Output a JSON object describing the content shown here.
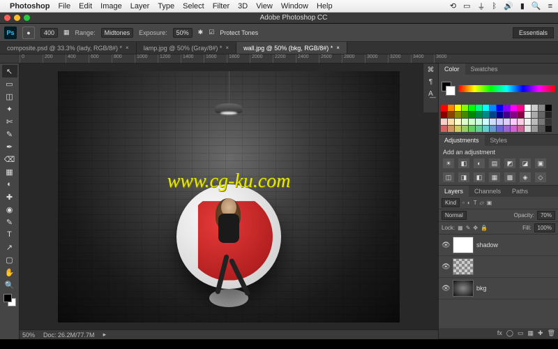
{
  "menubar": {
    "app": "Photoshop",
    "items": [
      "File",
      "Edit",
      "Image",
      "Layer",
      "Type",
      "Select",
      "Filter",
      "3D",
      "View",
      "Window",
      "Help"
    ],
    "right_icons": [
      "sync-icon",
      "display-icon",
      "wifi-icon",
      "bluetooth-icon",
      "volume-icon",
      "battery-icon",
      "clock-icon",
      "search-icon",
      "menu-icon"
    ]
  },
  "titlebar": {
    "title": "Adobe Photoshop CC"
  },
  "options": {
    "tool_size": "400",
    "range_label": "Range:",
    "range_value": "Midtones",
    "exposure_label": "Exposure:",
    "exposure_value": "50%",
    "protect_tones": "Protect Tones",
    "workspace": "Essentials"
  },
  "tabs": [
    {
      "label": "composite.psd @ 33.3% (lady, RGB/8#) *",
      "active": false
    },
    {
      "label": "lamp.jpg @ 50% (Gray/8#) *",
      "active": false
    },
    {
      "label": "wall.jpg @ 50% (bkg, RGB/8#) *",
      "active": true
    }
  ],
  "ruler_ticks": [
    "0",
    "200",
    "400",
    "600",
    "800",
    "1000",
    "1200",
    "1400",
    "1600",
    "1800",
    "2000",
    "2200",
    "2400",
    "2600",
    "2800",
    "3000",
    "3200",
    "3400",
    "3600"
  ],
  "tools": [
    "↖",
    "▭",
    "◫",
    "✦",
    "✄",
    "✎",
    "✒",
    "⌫",
    "▦",
    "◐",
    "✚",
    "◉",
    "✎",
    "T",
    "↗",
    "▢",
    "✋",
    "🔍"
  ],
  "statusbar": {
    "zoom": "50%",
    "doc": "Doc: 26.2M/77.7M"
  },
  "watermark": "www.cg-ku.com",
  "panels": {
    "color": {
      "tabs": [
        "Color",
        "Swatches"
      ]
    },
    "swatches": [
      "#ff0000",
      "#ff8800",
      "#ffff00",
      "#88ff00",
      "#00ff00",
      "#00ff88",
      "#00ffff",
      "#0088ff",
      "#0000ff",
      "#8800ff",
      "#ff00ff",
      "#ff0088",
      "#ffffff",
      "#cccccc",
      "#888888",
      "#000000",
      "#880000",
      "#884400",
      "#888800",
      "#448800",
      "#008800",
      "#008844",
      "#008888",
      "#004488",
      "#000088",
      "#440088",
      "#880088",
      "#880044",
      "#eeeeee",
      "#aaaaaa",
      "#666666",
      "#222222",
      "#ffcccc",
      "#ffddaa",
      "#ffffcc",
      "#ddffcc",
      "#ccffcc",
      "#ccffdd",
      "#ccffff",
      "#ccddff",
      "#ccccff",
      "#ddccff",
      "#ffccff",
      "#ffccdd",
      "#f0f0f0",
      "#bbbbbb",
      "#777777",
      "#333333",
      "#cc6666",
      "#cc9966",
      "#cccc66",
      "#99cc66",
      "#66cc66",
      "#66cc99",
      "#66cccc",
      "#6699cc",
      "#6666cc",
      "#9966cc",
      "#cc66cc",
      "#cc6699",
      "#dddddd",
      "#999999",
      "#555555",
      "#111111"
    ],
    "adjustments": {
      "tabs": [
        "Adjustments",
        "Styles"
      ],
      "label": "Add an adjustment",
      "icons": [
        "☀",
        "◧",
        "◐",
        "▤",
        "◩",
        "◪",
        "▣",
        "◫",
        "◨",
        "◧",
        "▦",
        "▩",
        "◈",
        "◇"
      ]
    },
    "layers": {
      "tabs": [
        "Layers",
        "Channels",
        "Paths"
      ],
      "kind_label": "Kind",
      "blend_mode": "Normal",
      "opacity_label": "Opacity:",
      "opacity_value": "70%",
      "lock_label": "Lock:",
      "fill_label": "Fill:",
      "fill_value": "100%",
      "items": [
        {
          "name": "shadow",
          "visible": true
        },
        {
          "name": "",
          "visible": true
        },
        {
          "name": "bkg",
          "visible": true
        }
      ],
      "bottom_icons": [
        "fx",
        "◯",
        "▭",
        "▦",
        "✚",
        "🗑"
      ]
    }
  },
  "collapsed_icons": [
    "⌘",
    "¶",
    "A͟"
  ]
}
